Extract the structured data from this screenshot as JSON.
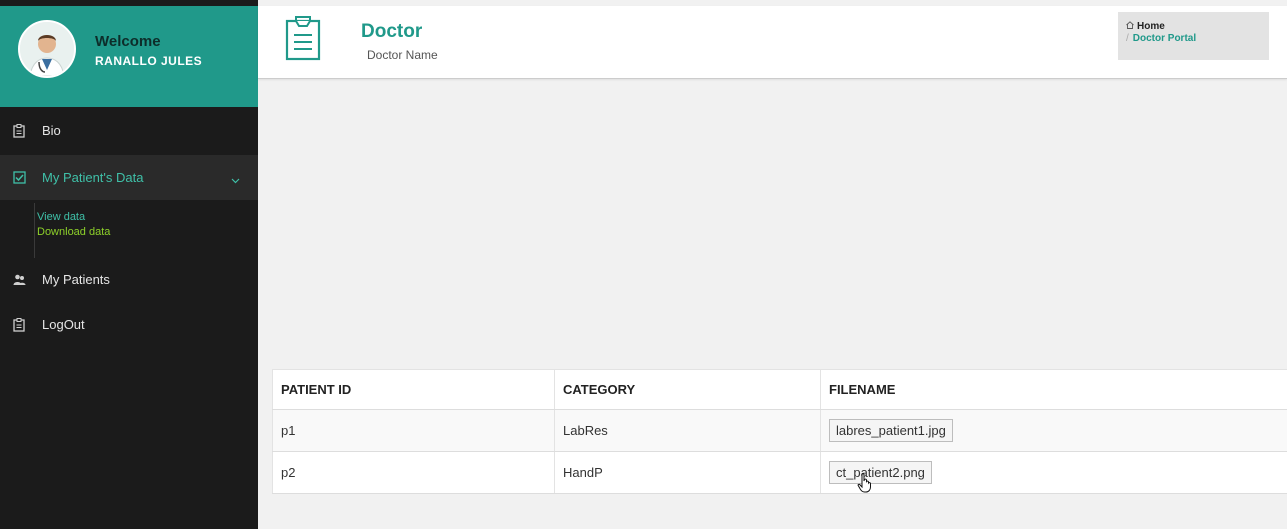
{
  "sidebar": {
    "welcome": "Welcome",
    "username": "RANALLO JULES",
    "items": [
      {
        "label": "Bio",
        "icon": "clipboard-icon"
      },
      {
        "label": "My Patient's Data",
        "icon": "checkbox-icon",
        "active": true
      },
      {
        "label": "My Patients",
        "icon": "users-icon"
      },
      {
        "label": "LogOut",
        "icon": "clipboard-icon"
      }
    ],
    "submenu": {
      "view": "View data",
      "download": "Download data"
    }
  },
  "header": {
    "title": "Doctor",
    "subtitle": "Doctor Name",
    "breadcrumb": {
      "home": "Home",
      "separator": "/",
      "current": "Doctor Portal"
    }
  },
  "table": {
    "headers": [
      "PATIENT ID",
      "CATEGORY",
      "FILENAME"
    ],
    "rows": [
      {
        "id": "p1",
        "category": "LabRes",
        "filename": "labres_patient1.jpg"
      },
      {
        "id": "p2",
        "category": "HandP",
        "filename": "ct_patient2.png"
      }
    ]
  },
  "colors": {
    "accent": "#20998a",
    "sidebar": "#1b1b1b",
    "submenu_highlight": "#8ed12a"
  }
}
